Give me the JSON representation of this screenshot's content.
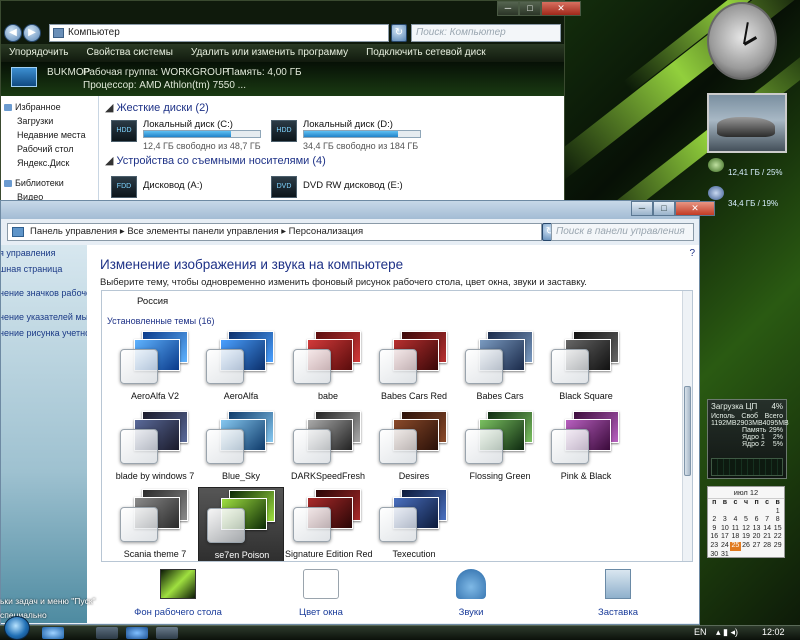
{
  "explorer": {
    "address": "Компьютер",
    "search_placeholder": "Поиск: Компьютер",
    "commands": [
      "Упорядочить",
      "Свойства системы",
      "Удалить или изменить программу",
      "Подключить сетевой диск"
    ],
    "computer_name": "BUKMOP",
    "workgroup": "Рабочая группа: WORKGROUP",
    "memory": "Память: 4,00 ГБ",
    "processor": "Процессор: AMD Athlon(tm) 7550 ...",
    "nav": [
      "Избранное",
      "Загрузки",
      "Недавние места",
      "Рабочий стол",
      "Яндекс.Диск",
      "Библиотеки",
      "Видео"
    ],
    "hdd_group": "Жесткие диски (2)",
    "drives": [
      {
        "name": "Локальный диск (C:)",
        "free": "12,4 ГБ свободно из 48,7 ГБ",
        "used_fraction": 0.75
      },
      {
        "name": "Локальный диск (D:)",
        "free": "34,4 ГБ свободно из 184 ГБ",
        "used_fraction": 0.81
      }
    ],
    "removable_group": "Устройства со съемными носителями (4)",
    "removable": [
      "Дисковод (A:)",
      "DVD RW дисковод (E:)"
    ]
  },
  "controlpanel": {
    "breadcrumb": "Панель управления  ▸  Все элементы панели управления  ▸  Персонализация",
    "search_placeholder": "Поиск в панели управления",
    "left_links": [
      "я управления",
      "шная страница",
      "нение значков рабочего",
      "нение указателей мыши",
      "нение рисунка учетной"
    ],
    "title": "Изменение изображения и звука на компьютере",
    "subtitle": "Выберите тему, чтобы одновременно изменить фоновый рисунок рабочего стола, цвет окна, звуки и заставку.",
    "region": "Россия",
    "installed": "Установленные темы (16)",
    "themes": [
      "AeroAlfa V2",
      "AeroAlfa",
      "babe",
      "Babes Cars Red",
      "Babes Cars",
      "Black Square",
      "blade by windows 7",
      "Blue_Sky",
      "DARKSpeedFresh",
      "Desires",
      "Flossing Green",
      "Pink & Black",
      "Scania theme 7",
      "se7en Poison",
      "Signature Edition Red",
      "Texecution"
    ],
    "selected_theme": "se7en Poison",
    "bottom": [
      "Фон рабочего стола",
      "Цвет окна",
      "Звуки",
      "Заставка"
    ]
  },
  "gadgets": {
    "cpu_title": "Загрузка ЦП",
    "cpu_percent": "4%",
    "cpu_cols": [
      "Исполь",
      "Своб",
      "Всего"
    ],
    "cpu_mem": [
      "1192MB",
      "2903MB",
      "4095MB"
    ],
    "mem_label": "Память",
    "mem_value": "29%",
    "core1_label": "Ядро 1",
    "core1_value": "2%",
    "core2_label": "Ядро 2",
    "core2_value": "5%",
    "drive1": "12,41 ГБ / 25%",
    "drive2": "34,4 ГБ / 19%",
    "calendar_month": "июл 12",
    "calendar_days": [
      "п",
      "в",
      "с",
      "ч",
      "п",
      "с",
      "в"
    ],
    "calendar_dates": [
      "",
      "",
      "",
      "",
      "",
      "",
      "1",
      "2",
      "3",
      "4",
      "5",
      "6",
      "7",
      "8",
      "9",
      "10",
      "11",
      "12",
      "13",
      "14",
      "15",
      "16",
      "17",
      "18",
      "19",
      "20",
      "21",
      "22",
      "23",
      "24",
      "25",
      "26",
      "27",
      "28",
      "29",
      "30",
      "31"
    ],
    "today": "25"
  },
  "taskbar": {
    "lang": "EN",
    "time": "12:02",
    "desktop_hint": "ьки задач и меню \"Пуск\"",
    "desktop_hint2": "специально"
  }
}
